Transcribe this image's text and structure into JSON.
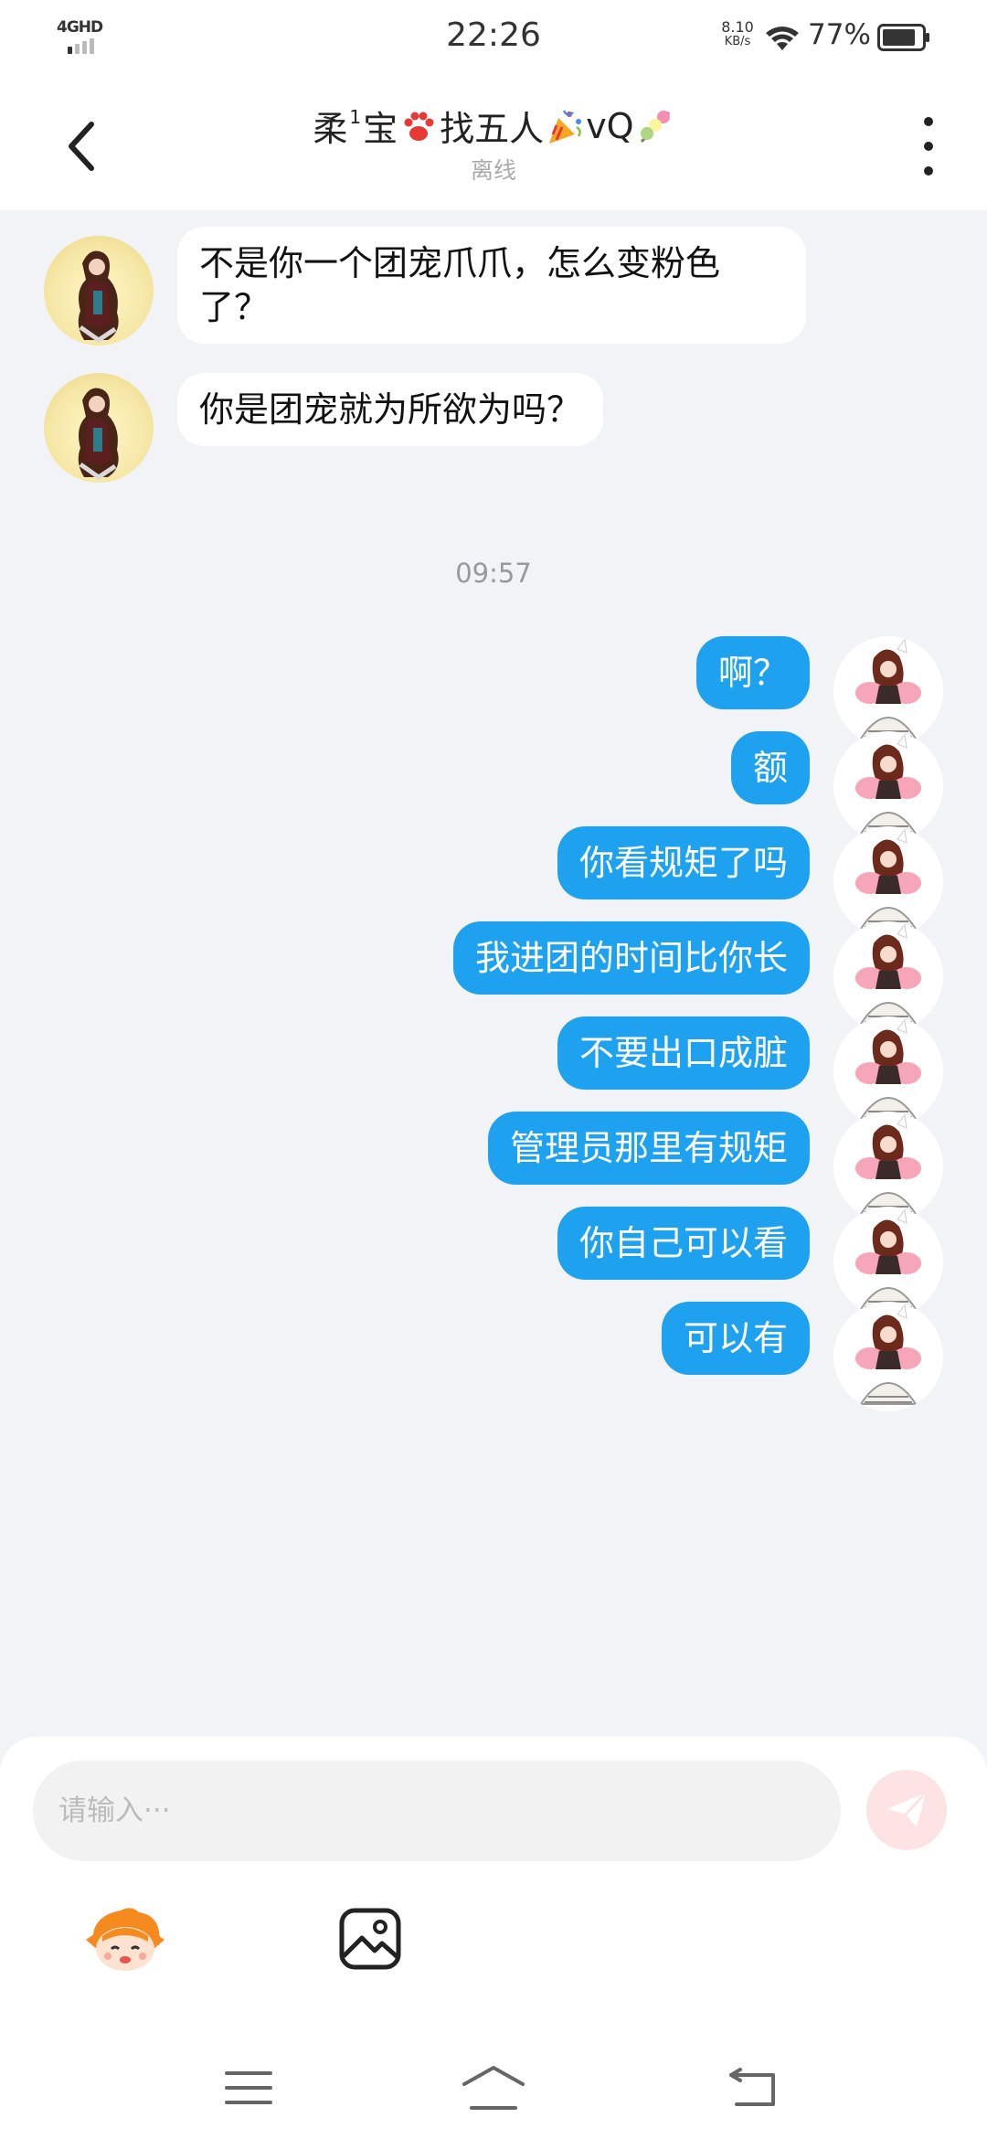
{
  "status_bar": {
    "network": "4GHD",
    "time": "22:26",
    "speed_value": "8.10",
    "speed_unit": "KB/s",
    "battery": "77%"
  },
  "header": {
    "title_part1": "柔",
    "title_sup": "1",
    "title_part2": "宝",
    "title_part3": "找五人",
    "title_part4": "vQ",
    "subtitle": "离线",
    "icons": [
      "back-arrow",
      "paw-emoji",
      "party-popper-emoji",
      "dango-emoji",
      "more-vertical"
    ]
  },
  "messages": {
    "m1": "不是你一个团宠爪爪，怎么变粉色了？",
    "m2": "你是团宠就为所欲为吗？",
    "time": "09:57",
    "m3": "啊？",
    "m4": "额",
    "m5": "你看规矩了吗",
    "m6": "我进团的时间比你长",
    "m7": "不要出口成脏",
    "m8": "管理员那里有规矩",
    "m9": "你自己可以看",
    "m10": "可以有"
  },
  "input": {
    "placeholder": "请输入···"
  },
  "toolbar": {
    "icons": [
      "emoji-mascot",
      "image-picker"
    ]
  },
  "navbar": {
    "icons": [
      "menu",
      "home",
      "back"
    ]
  },
  "colors": {
    "out_bubble": "#1ea2ef",
    "in_bubble": "#ffffff",
    "background": "#f2f3f6",
    "send_button": "#fde3e3"
  }
}
